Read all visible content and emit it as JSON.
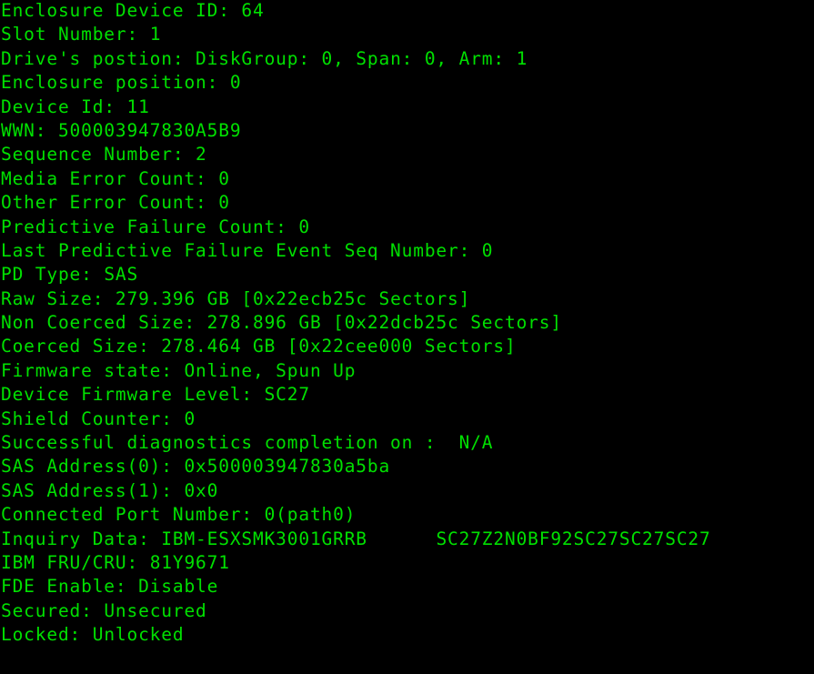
{
  "terminal": {
    "text_color": "#00e000",
    "background_color": "#000000",
    "lines": [
      {
        "key": "Enclosure Device ID",
        "sep": ": ",
        "value": "64"
      },
      {
        "key": "Slot Number",
        "sep": ": ",
        "value": "1"
      },
      {
        "key": "Drive's postion",
        "sep": ": ",
        "value": "DiskGroup: 0, Span: 0, Arm: 1"
      },
      {
        "key": "Enclosure position",
        "sep": ": ",
        "value": "0"
      },
      {
        "key": "Device Id",
        "sep": ": ",
        "value": "11"
      },
      {
        "key": "WWN",
        "sep": ": ",
        "value": "500003947830A5B9"
      },
      {
        "key": "Sequence Number",
        "sep": ": ",
        "value": "2"
      },
      {
        "key": "Media Error Count",
        "sep": ": ",
        "value": "0"
      },
      {
        "key": "Other Error Count",
        "sep": ": ",
        "value": "0"
      },
      {
        "key": "Predictive Failure Count",
        "sep": ": ",
        "value": "0"
      },
      {
        "key": "Last Predictive Failure Event Seq Number",
        "sep": ": ",
        "value": "0"
      },
      {
        "key": "PD Type",
        "sep": ": ",
        "value": "SAS"
      },
      {
        "key": "Raw Size",
        "sep": ": ",
        "value": "279.396 GB [0x22ecb25c Sectors]"
      },
      {
        "key": "Non Coerced Size",
        "sep": ": ",
        "value": "278.896 GB [0x22dcb25c Sectors]"
      },
      {
        "key": "Coerced Size",
        "sep": ": ",
        "value": "278.464 GB [0x22cee000 Sectors]"
      },
      {
        "key": "Firmware state",
        "sep": ": ",
        "value": "Online, Spun Up"
      },
      {
        "key": "Device Firmware Level",
        "sep": ": ",
        "value": "SC27"
      },
      {
        "key": "Shield Counter",
        "sep": ": ",
        "value": "0"
      },
      {
        "key": "Successful diagnostics completion on",
        "sep": " :  ",
        "value": "N/A"
      },
      {
        "key": "SAS Address(0)",
        "sep": ": ",
        "value": "0x500003947830a5ba"
      },
      {
        "key": "SAS Address(1)",
        "sep": ": ",
        "value": "0x0"
      },
      {
        "key": "Connected Port Number",
        "sep": ": ",
        "value": "0(path0)"
      },
      {
        "key": "Inquiry Data",
        "sep": ": ",
        "value": "IBM-ESXSMK3001GRRB      SC27Z2N0BF92SC27SC27SC27"
      },
      {
        "key": "IBM FRU/CRU",
        "sep": ": ",
        "value": "81Y9671"
      },
      {
        "key": "FDE Enable",
        "sep": ": ",
        "value": "Disable"
      },
      {
        "key": "Secured",
        "sep": ": ",
        "value": "Unsecured"
      },
      {
        "key": "Locked",
        "sep": ": ",
        "value": "Unlocked"
      }
    ]
  }
}
